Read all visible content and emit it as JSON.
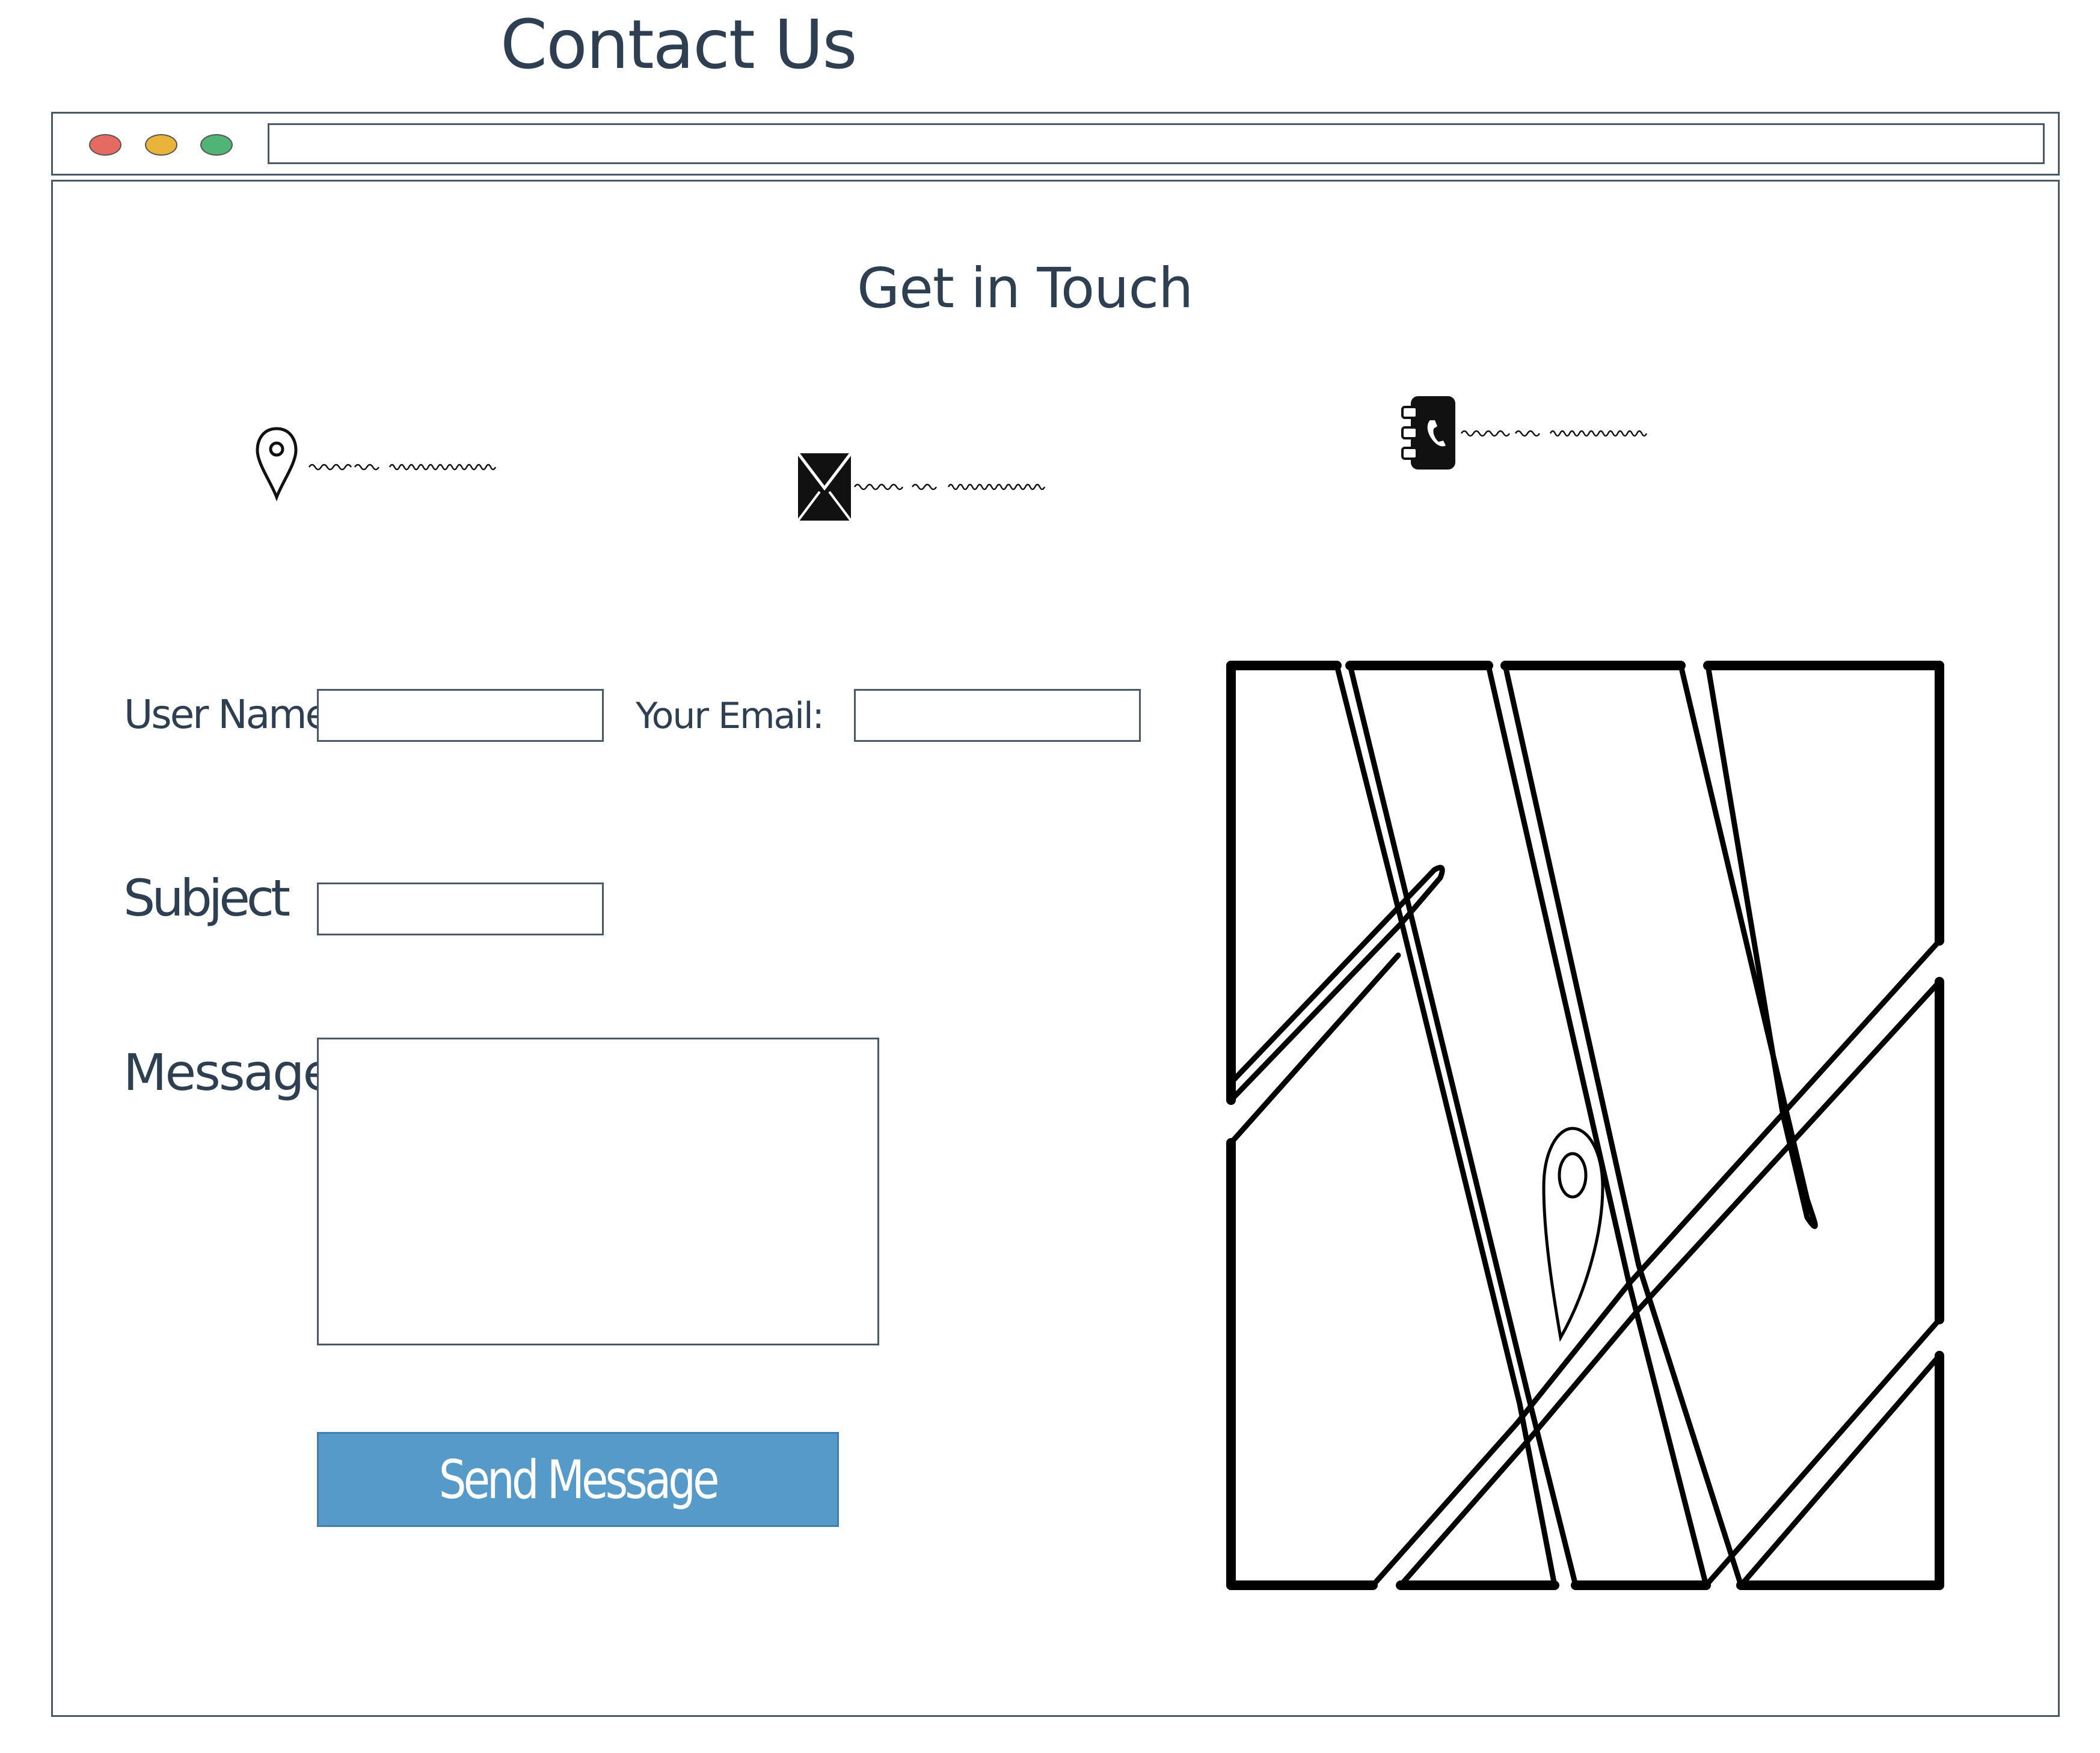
{
  "page": {
    "title": "Contact Us"
  },
  "browser": {
    "window_controls": [
      "close",
      "minimize",
      "maximize"
    ],
    "address_bar_value": ""
  },
  "contact_section": {
    "title": "Get in Touch",
    "info_items": [
      {
        "icon": "location-pin-icon"
      },
      {
        "icon": "envelope-icon"
      },
      {
        "icon": "phone-book-icon"
      }
    ]
  },
  "form": {
    "username_label": "User Name:",
    "username_value": "",
    "email_label": "Your Email:",
    "email_value": "",
    "subject_label": "Subject",
    "subject_value": "",
    "message_label": "Message",
    "message_value": "",
    "submit_label": "Send Message"
  },
  "map": {
    "icon": "map-icon"
  },
  "colors": {
    "text": "#2e3f52",
    "border": "#4a5868",
    "button": "#559ac8",
    "dot_red": "#e56b62",
    "dot_yellow": "#eab43b",
    "dot_green": "#4fb476"
  }
}
